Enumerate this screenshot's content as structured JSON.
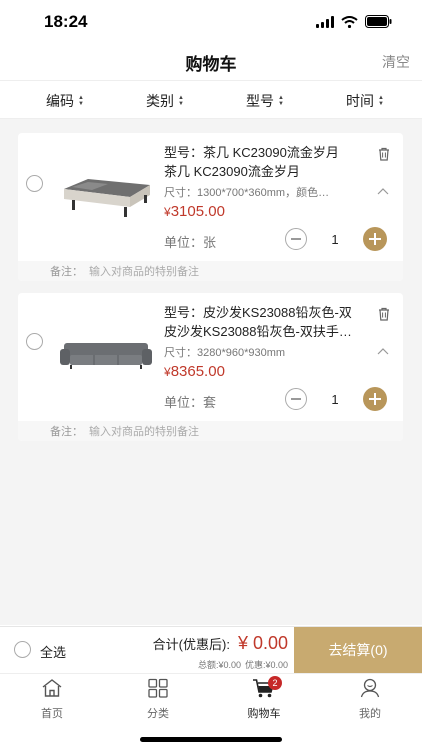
{
  "status_bar": {
    "time": "18:24"
  },
  "nav": {
    "title": "购物车",
    "clear_label": "清空"
  },
  "sort_bar": {
    "items": [
      {
        "label": "编码"
      },
      {
        "label": "类别"
      },
      {
        "label": "型号"
      },
      {
        "label": "时间"
      }
    ]
  },
  "cart_items": [
    {
      "model_line1": "型号：茶几 KC23090流金岁月",
      "model_line2": "茶几 KC23090流金岁月",
      "spec": "尺寸：1300*700*360mm，颜色…",
      "currency": "¥",
      "price": "3105.00",
      "unit": "单位：张",
      "quantity": "1",
      "remark_label": "备注：",
      "remark_placeholder": "输入对商品的特别备注"
    },
    {
      "model_line1": "型号：皮沙发KS23088铅灰色-双",
      "model_line2": "皮沙发KS23088铅灰色-双扶手大…",
      "spec": "尺寸：3280*960*930mm",
      "currency": "¥",
      "price": "8365.00",
      "unit": "单位：套",
      "quantity": "1",
      "remark_label": "备注：",
      "remark_placeholder": "输入对商品的特别备注"
    }
  ],
  "bottom_bar": {
    "select_all_label": "全选",
    "total_label": "合计(优惠后):",
    "total_value": "¥ 0.00",
    "total_amount": "总额:¥0.00",
    "discount": "优惠:¥0.00",
    "checkout_label": "去结算(0)"
  },
  "tabbar": {
    "tabs": [
      {
        "label": "首页",
        "icon": "home-icon"
      },
      {
        "label": "分类",
        "icon": "category-icon"
      },
      {
        "label": "购物车",
        "icon": "cart-icon",
        "badge": "2"
      },
      {
        "label": "我的",
        "icon": "profile-icon"
      }
    ]
  },
  "colors": {
    "accent_gold": "#b8965a",
    "checkout_bg": "#c8aa70",
    "price_red": "#c0392b",
    "badge_red": "#c62828"
  }
}
